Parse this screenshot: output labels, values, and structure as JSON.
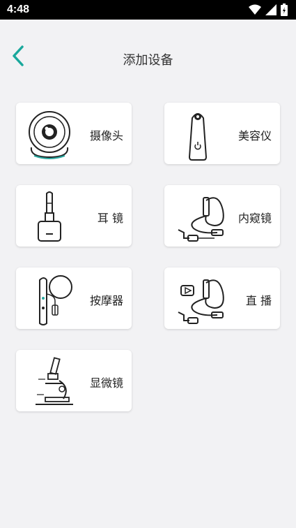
{
  "status": {
    "time": "4:48"
  },
  "header": {
    "title": "添加设备"
  },
  "devices": [
    {
      "label": "摄像头"
    },
    {
      "label": "美容仪"
    },
    {
      "label": "耳 镜"
    },
    {
      "label": "内窥镜"
    },
    {
      "label": "按摩器"
    },
    {
      "label": "直 播"
    },
    {
      "label": "显微镜"
    }
  ],
  "colors": {
    "accent": "#1aa89c",
    "background": "#f2f2f4",
    "card": "#ffffff"
  }
}
